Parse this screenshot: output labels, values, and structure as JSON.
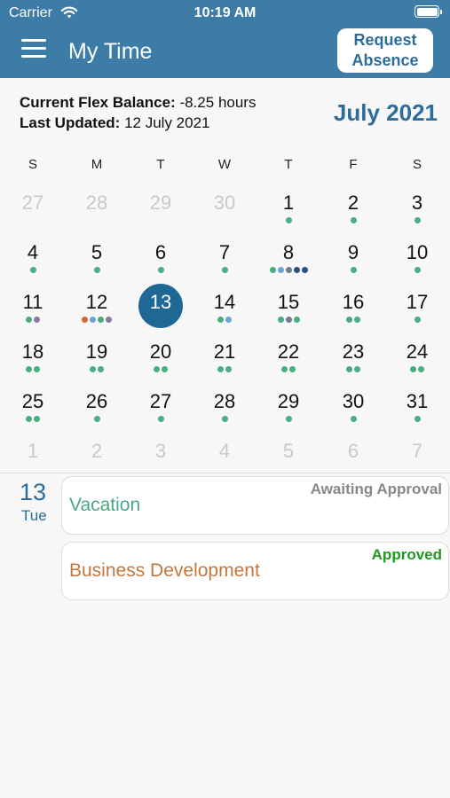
{
  "status_bar": {
    "carrier": "Carrier",
    "time": "10:19 AM"
  },
  "nav": {
    "title": "My Time",
    "request_line1": "Request",
    "request_line2": "Absence"
  },
  "header": {
    "balance_label": "Current Flex Balance:",
    "balance_value": "-8.25 hours",
    "updated_label": "Last Updated:",
    "updated_value": "12 July 2021",
    "month": "July 2021"
  },
  "colors": {
    "accent": "#2d6d9c",
    "nav_bar": "#3e7ca8",
    "dot_green": "#4aac80",
    "dot_blue": "#6aa6cf",
    "dot_navy": "#2c4f84",
    "dot_orange": "#d06a35",
    "dot_gray": "#6c7e8f",
    "dot_purple": "#8a7a9a"
  },
  "calendar": {
    "weekdays": [
      "S",
      "M",
      "T",
      "W",
      "T",
      "F",
      "S"
    ],
    "selected_day": "13",
    "weeks": [
      [
        {
          "d": "27",
          "m": true,
          "dots": []
        },
        {
          "d": "28",
          "m": true,
          "dots": []
        },
        {
          "d": "29",
          "m": true,
          "dots": []
        },
        {
          "d": "30",
          "m": true,
          "dots": []
        },
        {
          "d": "1",
          "dots": [
            "green"
          ]
        },
        {
          "d": "2",
          "dots": [
            "green"
          ]
        },
        {
          "d": "3",
          "dots": [
            "green"
          ]
        }
      ],
      [
        {
          "d": "4",
          "dots": [
            "green"
          ]
        },
        {
          "d": "5",
          "dots": [
            "green"
          ]
        },
        {
          "d": "6",
          "dots": [
            "green"
          ]
        },
        {
          "d": "7",
          "dots": [
            "green"
          ]
        },
        {
          "d": "8",
          "dots": [
            "green",
            "blue",
            "gray",
            "navy",
            "navy"
          ]
        },
        {
          "d": "9",
          "dots": [
            "green"
          ]
        },
        {
          "d": "10",
          "dots": [
            "green"
          ]
        }
      ],
      [
        {
          "d": "11",
          "dots": [
            "green",
            "purple"
          ]
        },
        {
          "d": "12",
          "dots": [
            "orange",
            "blue",
            "green",
            "purple"
          ]
        },
        {
          "d": "13",
          "sel": true,
          "dots": []
        },
        {
          "d": "14",
          "dots": [
            "green",
            "blue"
          ]
        },
        {
          "d": "15",
          "dots": [
            "green",
            "gray",
            "green"
          ]
        },
        {
          "d": "16",
          "dots": [
            "green",
            "green"
          ]
        },
        {
          "d": "17",
          "dots": [
            "green"
          ]
        }
      ],
      [
        {
          "d": "18",
          "dots": [
            "green",
            "green"
          ]
        },
        {
          "d": "19",
          "dots": [
            "green",
            "green"
          ]
        },
        {
          "d": "20",
          "dots": [
            "green",
            "green"
          ]
        },
        {
          "d": "21",
          "dots": [
            "green",
            "green"
          ]
        },
        {
          "d": "22",
          "dots": [
            "green",
            "green"
          ]
        },
        {
          "d": "23",
          "dots": [
            "green",
            "green"
          ]
        },
        {
          "d": "24",
          "dots": [
            "green",
            "green"
          ]
        }
      ],
      [
        {
          "d": "25",
          "dots": [
            "green",
            "green"
          ]
        },
        {
          "d": "26",
          "dots": [
            "green"
          ]
        },
        {
          "d": "27",
          "dots": [
            "green"
          ]
        },
        {
          "d": "28",
          "dots": [
            "green"
          ]
        },
        {
          "d": "29",
          "dots": [
            "green"
          ]
        },
        {
          "d": "30",
          "dots": [
            "green"
          ]
        },
        {
          "d": "31",
          "dots": [
            "green"
          ]
        }
      ],
      [
        {
          "d": "1",
          "m": true,
          "dots": []
        },
        {
          "d": "2",
          "m": true,
          "dots": []
        },
        {
          "d": "3",
          "m": true,
          "dots": []
        },
        {
          "d": "4",
          "m": true,
          "dots": []
        },
        {
          "d": "5",
          "m": true,
          "dots": []
        },
        {
          "d": "6",
          "m": true,
          "dots": []
        },
        {
          "d": "7",
          "m": true,
          "dots": []
        }
      ]
    ]
  },
  "selected": {
    "date": "13",
    "weekday": "Tue"
  },
  "events": [
    {
      "title": "Vacation",
      "status": "Awaiting Approval",
      "title_color": "#4aa882",
      "status_color": "#888888"
    },
    {
      "title": "Business Development",
      "status": "Approved",
      "title_color": "#c4773d",
      "status_color": "#1f9a1f"
    }
  ]
}
